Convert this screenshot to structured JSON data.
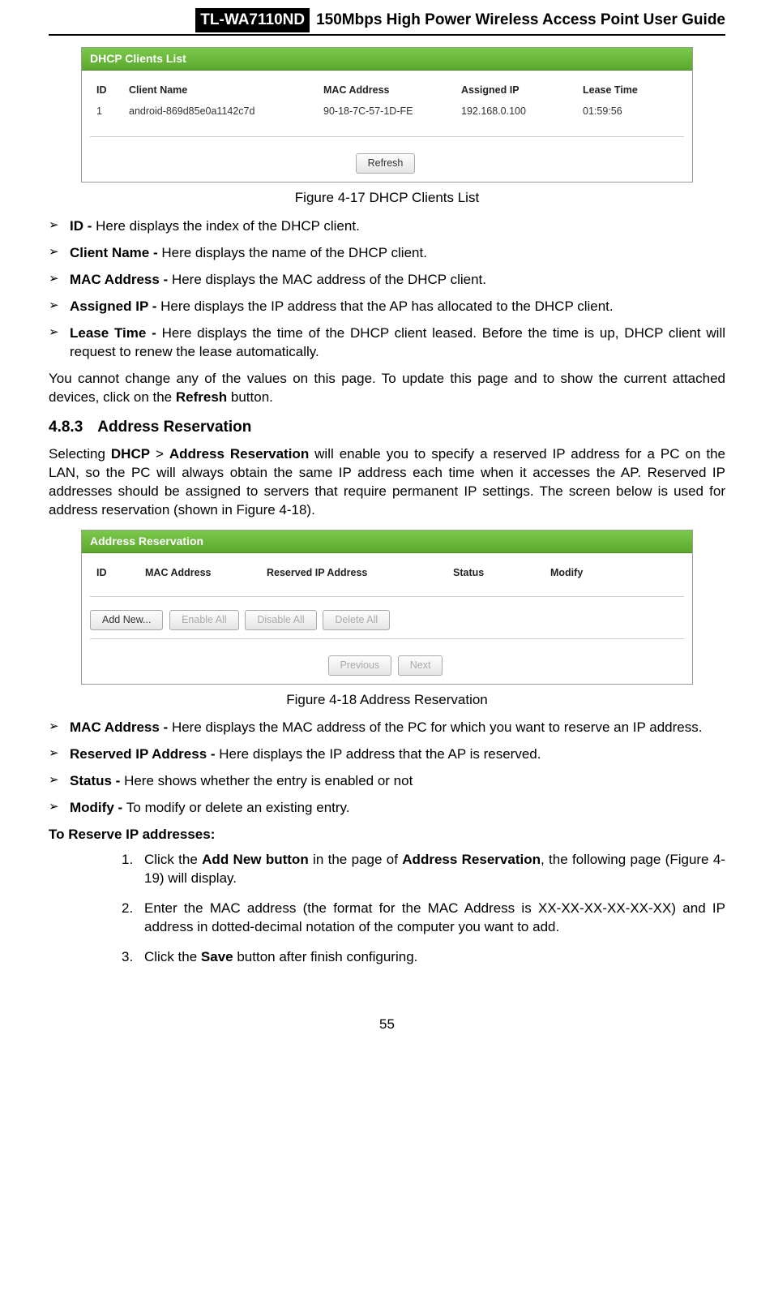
{
  "header": {
    "model": "TL-WA7110ND",
    "title": "150Mbps High Power Wireless Access Point User Guide"
  },
  "fig17": {
    "panel_title": "DHCP Clients List",
    "cols": {
      "id": "ID",
      "client": "Client Name",
      "mac": "MAC Address",
      "ip": "Assigned IP",
      "lease": "Lease Time"
    },
    "row": {
      "id": "1",
      "client": "android-869d85e0a1142c7d",
      "mac": "90-18-7C-57-1D-FE",
      "ip": "192.168.0.100",
      "lease": "01:59:56"
    },
    "refresh": "Refresh",
    "caption": "Figure 4-17 DHCP Clients List"
  },
  "bullets17": [
    {
      "bold": "ID - ",
      "text": "Here displays the index of the DHCP client."
    },
    {
      "bold": "Client Name - ",
      "text": "Here displays the name of the DHCP client."
    },
    {
      "bold": "MAC Address - ",
      "text": "Here displays the MAC address of the DHCP client."
    },
    {
      "bold": "Assigned IP - ",
      "text": "Here displays the IP address that the AP has allocated to the DHCP client."
    },
    {
      "bold": "Lease Time - ",
      "text": "Here displays the time of the DHCP client leased. Before the time is up, DHCP client will request to renew the lease automatically."
    }
  ],
  "para17": {
    "pre": "You cannot change any of the values on this page. To update this page and to show the current attached devices, click on the ",
    "bold": "Refresh",
    "post": " button."
  },
  "sec": {
    "no": "4.8.3",
    "title": "Address Reservation"
  },
  "para_sec": {
    "pre": "Selecting ",
    "b1": "DHCP",
    "mid1": " > ",
    "b2": "Address Reservation",
    "post": " will enable you to specify a reserved IP address for a PC on the LAN, so the PC will always obtain the same IP address each time when it accesses the AP. Reserved IP addresses should be assigned to servers that require permanent IP settings. The screen below is used for address reservation (shown in Figure 4-18)."
  },
  "fig18": {
    "panel_title": "Address Reservation",
    "cols": {
      "id": "ID",
      "mac": "MAC Address",
      "rip": "Reserved IP Address",
      "status": "Status",
      "modify": "Modify"
    },
    "btns": {
      "add": "Add New...",
      "enable": "Enable All",
      "disable": "Disable All",
      "delete": "Delete All",
      "prev": "Previous",
      "next": "Next"
    },
    "caption": "Figure 4-18 Address Reservation"
  },
  "bullets18": [
    {
      "bold": "MAC Address - ",
      "text": "Here displays the MAC address of the PC for which you want to reserve an IP address."
    },
    {
      "bold": "Reserved IP Address - ",
      "text": "Here displays the IP address that the AP is reserved."
    },
    {
      "bold": "Status - ",
      "text": "Here shows whether the entry is enabled or not"
    },
    {
      "bold": "Modify - ",
      "text": "To modify or delete an existing entry."
    }
  ],
  "reserve_head": "To Reserve IP addresses:",
  "steps": [
    {
      "n": "1.",
      "pre": "Click the ",
      "b1": "Add New button",
      "mid": " in the page of ",
      "b2": "Address Reservation",
      "post": ", the following page (Figure 4-19) will display."
    },
    {
      "n": "2.",
      "pre": "Enter the MAC address (the format for the MAC Address is XX-XX-XX-XX-XX-XX) and IP address in dotted-decimal notation of  the computer you want to add.",
      "b1": "",
      "mid": "",
      "b2": "",
      "post": ""
    },
    {
      "n": "3.",
      "pre": "Click the ",
      "b1": "Save",
      "mid": " button after finish configuring.",
      "b2": "",
      "post": ""
    }
  ],
  "pagenum": "55"
}
